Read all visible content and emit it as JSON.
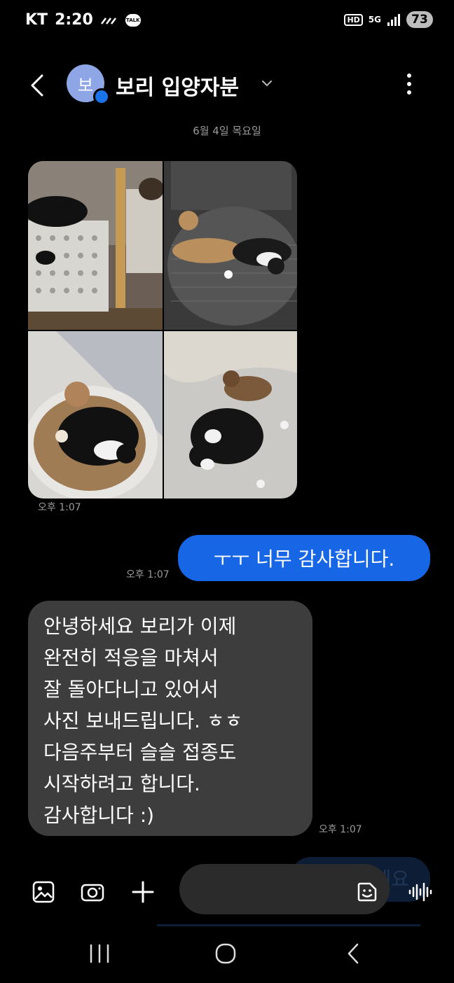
{
  "status_bar": {
    "carrier": "KT",
    "time": "2:20",
    "talk_badge": "TALK",
    "hd_badge": "HD",
    "network": "5G",
    "battery": "73"
  },
  "header": {
    "avatar_initial": "보",
    "contact_name": "보리 입양자분"
  },
  "conversation": {
    "date_separator": "6월 4일 목요일",
    "photo_message": {
      "photos": [
        "cat-in-basket-photo",
        "kittens-on-chair-photo",
        "cats-in-scratcher-bed-photo",
        "cats-on-bed-photo"
      ],
      "time": "오후 1:07"
    },
    "sent_message": {
      "text": "ㅜㅜ 너무 감사합니다.",
      "time": "오후 1:07"
    },
    "received_message": {
      "text": "안녕하세요 보리가 이제\n완전히 적응을 마쳐서\n잘 돌아다니고 있어서\n사진 보내드립니다. ㅎㅎ\n다음주부터 슬슬 접종도\n시작하려고 합니다.\n감사합니다 :)",
      "time": "오후 1:07"
    },
    "suggested_reply_partial": "세요"
  },
  "input_bar": {
    "placeholder": ""
  },
  "colors": {
    "background": "#000000",
    "sent_bubble": "#1766e6",
    "received_bubble": "#3d3d3d",
    "avatar": "#8ea6e6",
    "timestamp": "#9a9a9a"
  }
}
